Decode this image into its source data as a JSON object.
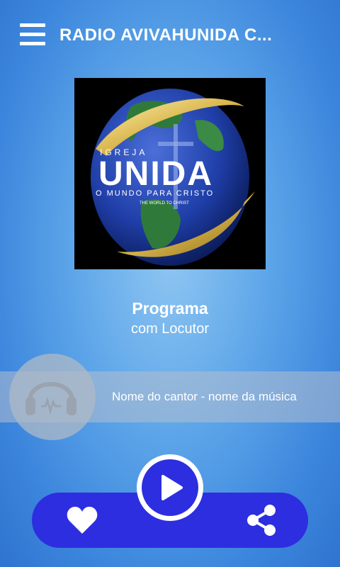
{
  "app": {
    "title": "RADIO AVIVAHUNIDA C..."
  },
  "artwork": {
    "top_text": "IGREJA",
    "main_text": "UNIDA",
    "slogan": "O MUNDO PARA CRISTO",
    "subslogan": "THE WORLD TO CHRIST"
  },
  "now_playing": {
    "program": "Programa",
    "host": "com Locutor",
    "song": "Nome do cantor - nome da música"
  },
  "icons": {
    "menu": "hamburger-menu-icon",
    "headphones": "headphones-icon",
    "play": "play-icon",
    "favorite": "heart-icon",
    "share": "share-icon"
  },
  "colors": {
    "accent": "#2d2ee0",
    "background": "#4a95e2"
  }
}
